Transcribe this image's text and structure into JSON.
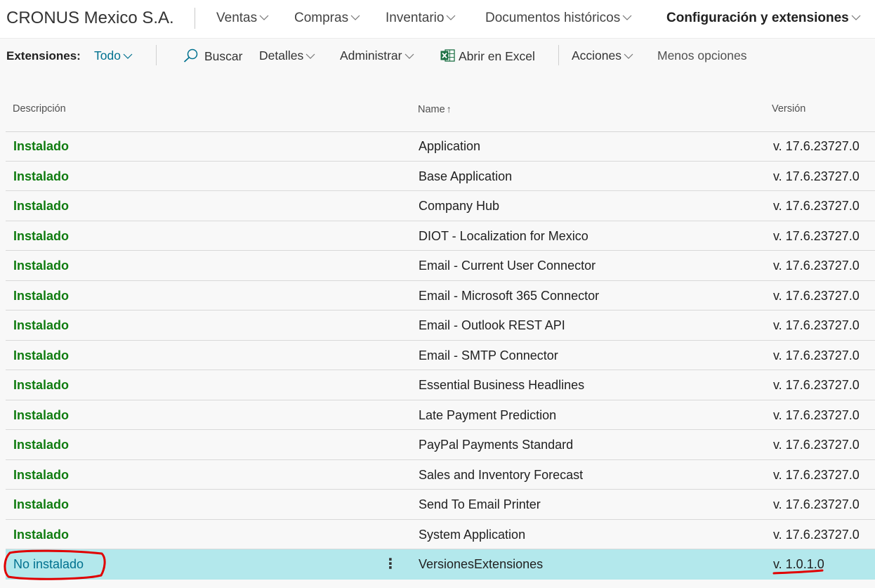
{
  "company": "CRONUS Mexico S.A.",
  "nav": {
    "items": [
      {
        "label": "Ventas"
      },
      {
        "label": "Compras"
      },
      {
        "label": "Inventario"
      },
      {
        "label": "Documentos históricos"
      },
      {
        "label": "Configuración y extensiones",
        "active": true
      }
    ]
  },
  "actionbar": {
    "filter_label": "Extensiones:",
    "filter_value": "Todo",
    "search": "Buscar",
    "details": "Detalles",
    "manage": "Administrar",
    "excel": "Abrir en Excel",
    "actions": "Acciones",
    "fewer_options": "Menos opciones"
  },
  "grid": {
    "columns": {
      "description": "Descripción",
      "name": "Name",
      "name_sort": "↑",
      "version": "Versión"
    },
    "rows": [
      {
        "status": "Instalado",
        "name": "Application",
        "version": "v. 17.6.23727.0"
      },
      {
        "status": "Instalado",
        "name": "Base Application",
        "version": "v. 17.6.23727.0"
      },
      {
        "status": "Instalado",
        "name": "Company Hub",
        "version": "v. 17.6.23727.0"
      },
      {
        "status": "Instalado",
        "name": "DIOT - Localization for Mexico",
        "version": "v. 17.6.23727.0"
      },
      {
        "status": "Instalado",
        "name": "Email - Current User Connector",
        "version": "v. 17.6.23727.0"
      },
      {
        "status": "Instalado",
        "name": "Email - Microsoft 365 Connector",
        "version": "v. 17.6.23727.0"
      },
      {
        "status": "Instalado",
        "name": "Email - Outlook REST API",
        "version": "v. 17.6.23727.0"
      },
      {
        "status": "Instalado",
        "name": "Email - SMTP Connector",
        "version": "v. 17.6.23727.0"
      },
      {
        "status": "Instalado",
        "name": "Essential Business Headlines",
        "version": "v. 17.6.23727.0"
      },
      {
        "status": "Instalado",
        "name": "Late Payment Prediction",
        "version": "v. 17.6.23727.0"
      },
      {
        "status": "Instalado",
        "name": "PayPal Payments Standard",
        "version": "v. 17.6.23727.0"
      },
      {
        "status": "Instalado",
        "name": "Sales and Inventory Forecast",
        "version": "v. 17.6.23727.0"
      },
      {
        "status": "Instalado",
        "name": "Send To Email Printer",
        "version": "v. 17.6.23727.0"
      },
      {
        "status": "Instalado",
        "name": "System Application",
        "version": "v. 17.6.23727.0"
      },
      {
        "status": "No instalado",
        "name": "VersionesExtensiones",
        "version": "v. 1.0.1.0",
        "selected": true,
        "menu": "⋮"
      }
    ]
  },
  "colors": {
    "installed": "#107c10",
    "accent": "#00718f",
    "selected_row": "#b3e8ec",
    "annotation": "#e00000"
  }
}
